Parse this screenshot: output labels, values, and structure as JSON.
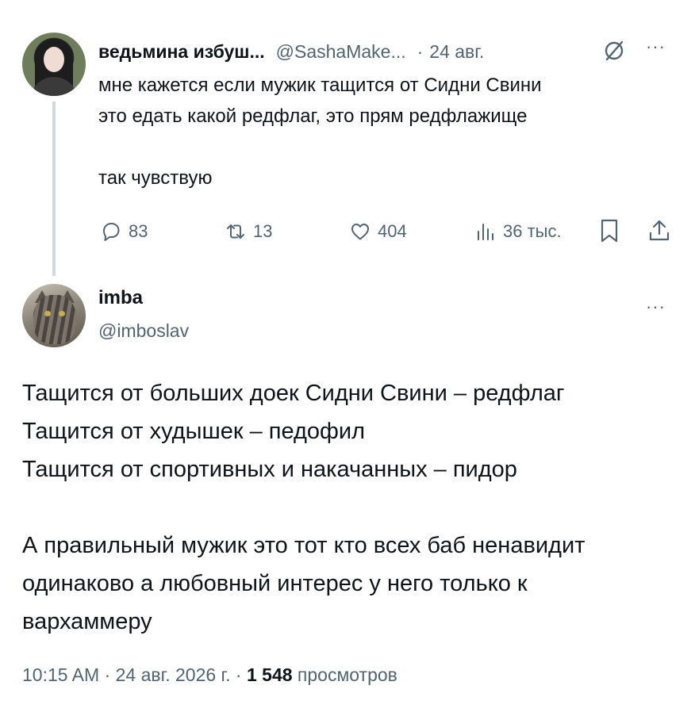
{
  "parent_tweet": {
    "author_name": "ведьмина избуш...",
    "handle": "@SashaMake...",
    "separator": "·",
    "date": "24 авг.",
    "text_lines": [
      "мне кажется если мужик тащится от Сидни Свини",
      "это едать какой редфлаг, это прям редфлажище",
      "",
      "так чувствую"
    ],
    "stats": {
      "replies": "83",
      "reposts": "13",
      "likes": "404",
      "views": "36 тыс."
    }
  },
  "main_tweet": {
    "author_name": "imba",
    "handle": "@imboslav",
    "text_lines": [
      "Тащится от больших доек Сидни Свини – редфлаг",
      "Тащится от худышек – педофил",
      "Тащится от спортивных и накачанных – пидор",
      "",
      "А правильный мужик это тот кто всех баб ненавидит",
      "одинаково а любовный интерес у него только к",
      "вархаммеру"
    ],
    "meta": {
      "time": "10:15 AM",
      "date": "24 авг. 2026 г.",
      "separator": "·",
      "views_count": "1 548",
      "views_label": "просмотров"
    }
  },
  "more_label": "···",
  "icons": {
    "reply": "reply-icon",
    "repost": "repost-icon",
    "like": "heart-icon",
    "views": "views-chart-icon",
    "bookmark": "bookmark-icon",
    "share": "share-icon",
    "grok": "grok-icon"
  },
  "colors": {
    "text_primary": "#0f1419",
    "text_secondary": "#536471",
    "thread_line": "#cfd9de"
  }
}
